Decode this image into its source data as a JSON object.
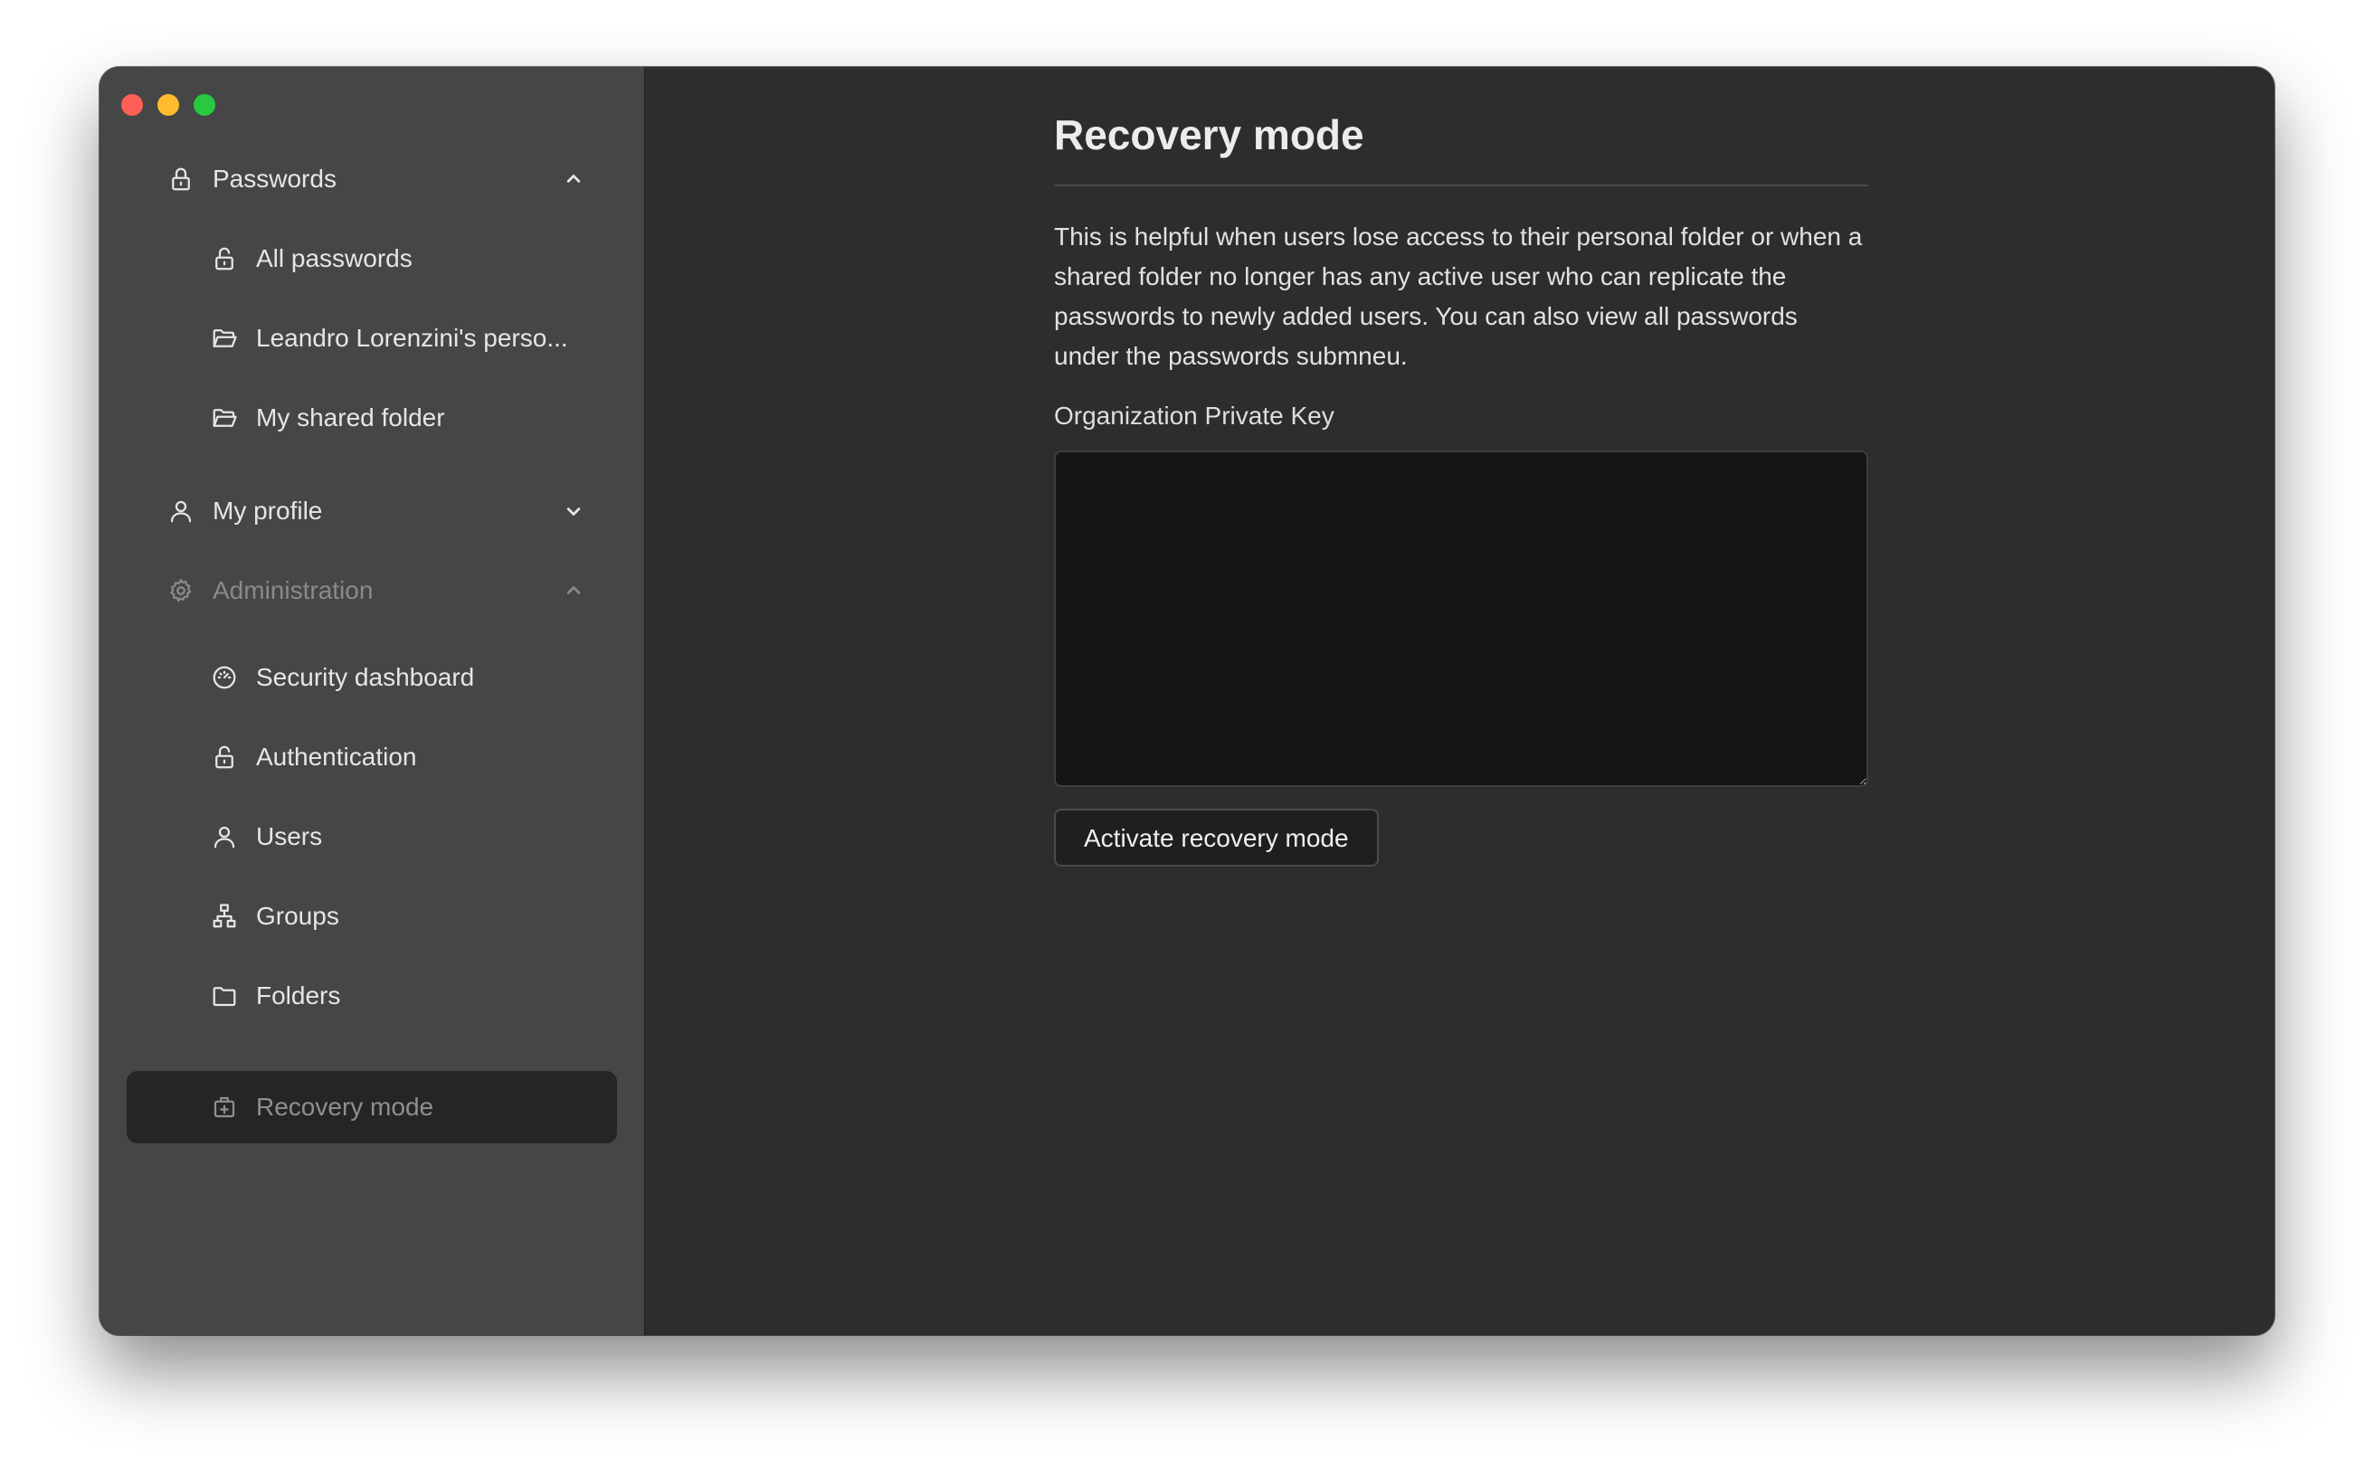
{
  "sidebar": {
    "passwords_section": {
      "label": "Passwords",
      "icon": "lock-icon",
      "expanded": true
    },
    "password_items": [
      {
        "label": "All passwords",
        "icon": "lock-open-icon"
      },
      {
        "label": "Leandro Lorenzini's perso...",
        "icon": "folder-open-icon"
      },
      {
        "label": "My shared folder",
        "icon": "folder-open-icon"
      }
    ],
    "profile_section": {
      "label": "My profile",
      "icon": "user-icon",
      "expanded": false
    },
    "admin_section": {
      "label": "Administration",
      "icon": "gear-icon",
      "expanded": true
    },
    "admin_items": [
      {
        "label": "Security dashboard",
        "icon": "gauge-icon"
      },
      {
        "label": "Authentication",
        "icon": "lock-open-icon"
      },
      {
        "label": "Users",
        "icon": "user-icon"
      },
      {
        "label": "Groups",
        "icon": "hierarchy-icon"
      },
      {
        "label": "Folders",
        "icon": "folder-icon"
      },
      {
        "label": "Recovery mode",
        "icon": "recovery-box-icon",
        "active": true
      }
    ]
  },
  "main": {
    "title": "Recovery mode",
    "description": "This is helpful when users lose access to their personal folder or when a shared folder no longer has any active user who can replicate the passwords to newly added users. You can also view all passwords under the passwords submneu.",
    "key_label": "Organization Private Key",
    "key_value": "",
    "activate_button": "Activate recovery mode"
  },
  "colors": {
    "sidebar_bg": "#464646",
    "main_bg": "#2d2d2d",
    "active_item_bg": "#252526",
    "textarea_bg": "#151515"
  }
}
